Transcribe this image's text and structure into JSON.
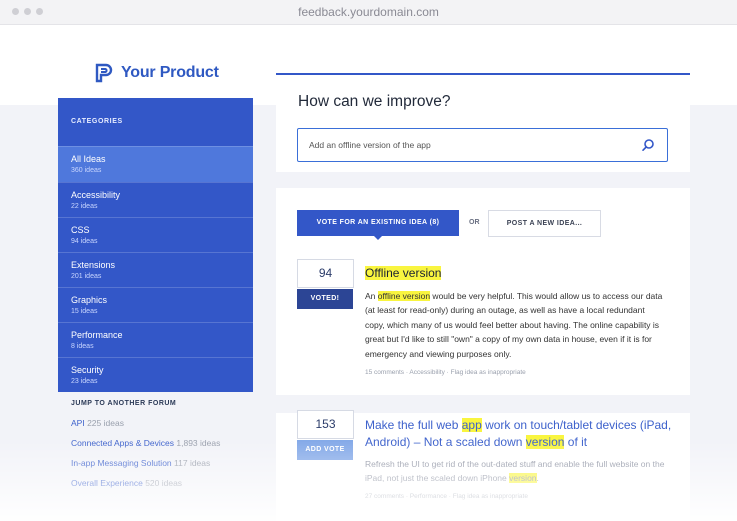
{
  "browser": {
    "url": "feedback.yourdomain.com"
  },
  "brand": {
    "name": "Your Product",
    "color": "#2f59c2"
  },
  "sidebar": {
    "heading": "CATEGORIES",
    "items": [
      {
        "label": "All Ideas",
        "count": "360 ideas",
        "active": true
      },
      {
        "label": "Accessibility",
        "count": "22 ideas"
      },
      {
        "label": "CSS",
        "count": "94 ideas"
      },
      {
        "label": "Extensions",
        "count": "201 ideas"
      },
      {
        "label": "Graphics",
        "count": "15 ideas"
      },
      {
        "label": "Performance",
        "count": "8 ideas"
      },
      {
        "label": "Security",
        "count": "23 ideas"
      }
    ]
  },
  "forums": {
    "heading": "JUMP TO ANOTHER FORUM",
    "items": [
      {
        "label": "API",
        "count": "225 ideas"
      },
      {
        "label": "Connected Apps & Devices",
        "count": "1,893 ideas"
      },
      {
        "label": "In-app Messaging Solution",
        "count": "117 ideas"
      },
      {
        "label": "Overall Experience",
        "count": "520 ideas"
      }
    ]
  },
  "main": {
    "heading": "How can we improve?",
    "search_value": "Add an offline version of the app",
    "tabs": {
      "vote": "VOTE FOR AN EXISTING IDEA (8)",
      "or": "OR",
      "post": "POST A NEW IDEA..."
    }
  },
  "ideas": [
    {
      "votes": "94",
      "button": "VOTED!",
      "title": "Offline version",
      "body_pre": "An ",
      "body_hl": "offline version",
      "body_post": " would be very helpful. This would allow us to access our data (at least for read-only) during an outage, as well as have a local redundant copy, which many of us would feel better about having. The online capability is great but I'd like to still \"own\" a copy of my own data in house, even if it is for emergency and viewing purposes only.",
      "meta": "15 comments  ·  Accessibility  ·  Flag idea as inappropriate"
    },
    {
      "votes": "153",
      "button": "ADD VOTE",
      "title_1": "Make the full web ",
      "title_hl1": "app",
      "title_2": " work on touch/tablet devices (iPad, Android) – Not a scaled down ",
      "title_hl2": "version",
      "title_3": " of it",
      "body_pre": "Refresh the UI to get rid of the out-dated stuff and enable the full website on the iPad, not just the scaled down iPhone ",
      "body_hl": "version",
      "body_post": ".",
      "meta": "27 comments  ·  Performance  ·  Flag idea as inappropriate"
    }
  ]
}
